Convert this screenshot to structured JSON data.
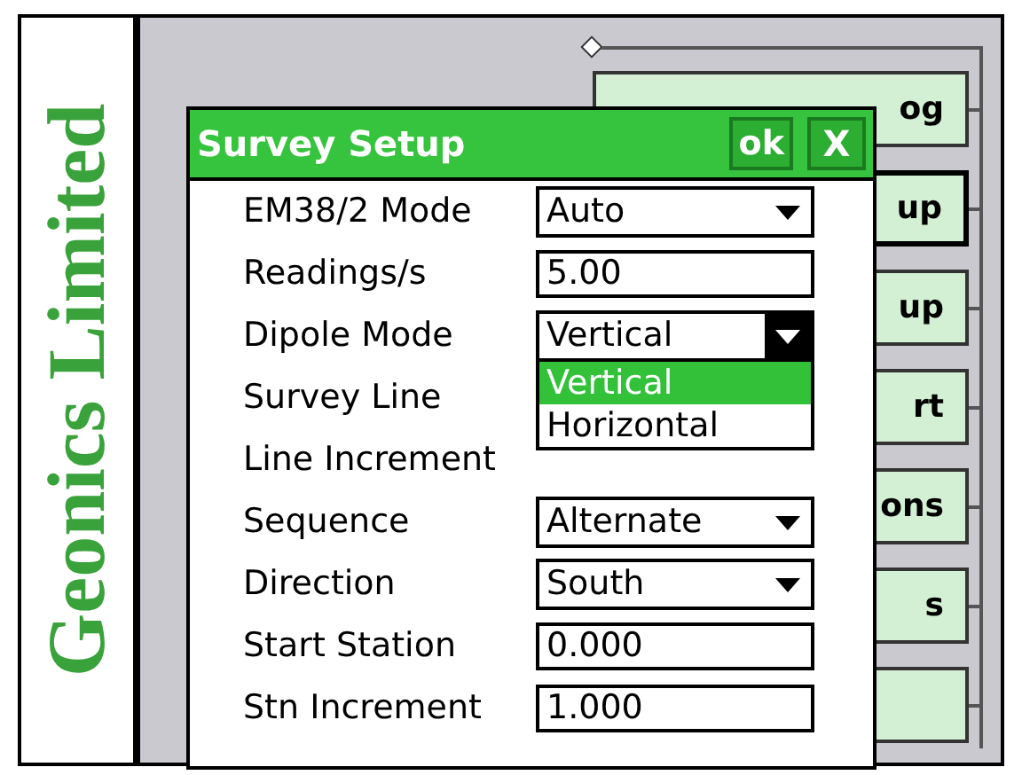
{
  "brand": {
    "text": "Geonics Limited"
  },
  "menu_buttons": [
    {
      "label": "og",
      "selected": false
    },
    {
      "label": "up",
      "selected": true
    },
    {
      "label": "up",
      "selected": false
    },
    {
      "label": "rt",
      "selected": false
    },
    {
      "label": "ons",
      "selected": false
    },
    {
      "label": "s",
      "selected": false
    },
    {
      "selected": false
    }
  ],
  "dialog": {
    "title": "Survey Setup",
    "ok": "ok",
    "close": "X",
    "fields": [
      {
        "label": "EM38/2 Mode",
        "kind": "select",
        "value": "Auto",
        "open": false
      },
      {
        "label": "Readings/s",
        "kind": "text",
        "value": "5.00"
      },
      {
        "label": "Dipole Mode",
        "kind": "select",
        "value": "Vertical",
        "open": true,
        "options": [
          {
            "label": "Vertical",
            "selected": true
          },
          {
            "label": "Horizontal",
            "selected": false
          }
        ]
      },
      {
        "label": "Survey Line",
        "kind": "hidden"
      },
      {
        "label": "Line Increment",
        "kind": "hidden"
      },
      {
        "label": "Sequence",
        "kind": "select",
        "value": "Alternate",
        "open": false
      },
      {
        "label": "Direction",
        "kind": "select",
        "value": "South",
        "open": false
      },
      {
        "label": "Start Station",
        "kind": "text",
        "value": "0.000"
      },
      {
        "label": "Stn Increment",
        "kind": "text",
        "value": "1.000"
      }
    ]
  }
}
